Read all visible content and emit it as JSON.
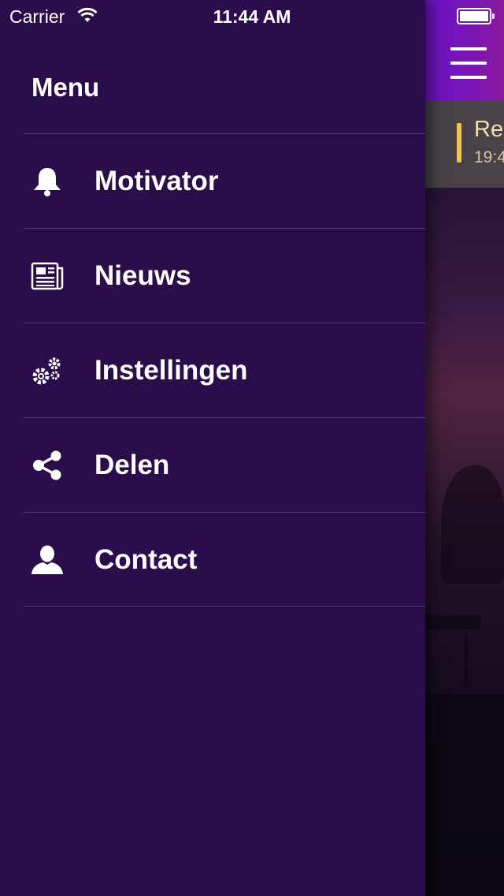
{
  "status_bar": {
    "carrier": "Carrier",
    "time": "11:44 AM"
  },
  "menu": {
    "title": "Menu",
    "items": [
      {
        "label": "Motivator",
        "icon": "bell-icon"
      },
      {
        "label": "Nieuws",
        "icon": "newspaper-icon"
      },
      {
        "label": "Instellingen",
        "icon": "gears-icon"
      },
      {
        "label": "Delen",
        "icon": "share-icon"
      },
      {
        "label": "Contact",
        "icon": "user-icon"
      }
    ]
  },
  "content": {
    "menu_icon": "hamburger-icon",
    "reminder": {
      "title": "Re",
      "time": "19:4"
    }
  },
  "colors": {
    "drawer_background": "#2c0d4b",
    "navbar_gradient_start": "#6b13c6",
    "navbar_gradient_end": "#8a1a9e",
    "reminder_accent": "#f1c94a",
    "divider": "#553e6e"
  }
}
